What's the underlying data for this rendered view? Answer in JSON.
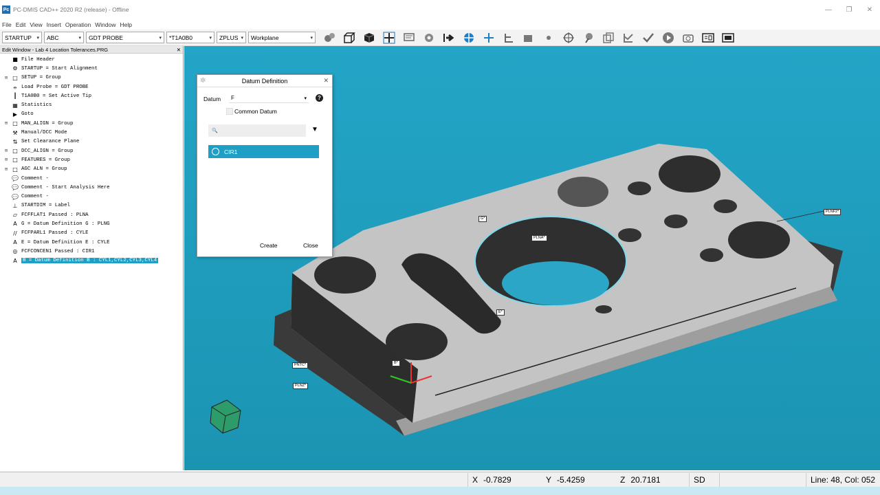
{
  "window": {
    "title": "PC-DMIS CAD++ 2020 R2 (release) - Offline",
    "icon_label": "Pc",
    "controls": [
      "—",
      "❐",
      "✕"
    ]
  },
  "menu": [
    "File",
    "Edit",
    "View",
    "Insert",
    "Operation",
    "Window",
    "Help"
  ],
  "toolbar": {
    "combos": [
      {
        "value": "STARTUP",
        "width": 58
      },
      {
        "value": "ABC",
        "width": 58
      },
      {
        "value": "GDT PROBE",
        "width": 114
      },
      {
        "value": "*T1A0B0",
        "width": 70
      },
      {
        "value": "ZPLUS",
        "width": 43
      },
      {
        "value": "Workplane",
        "width": 98
      }
    ]
  },
  "edit_window": {
    "title": "Edit Window - Lab 4 Location Tolerances.PRG",
    "close": "✕",
    "items": [
      {
        "exp": "",
        "icon": "■",
        "label": "File Header"
      },
      {
        "exp": "",
        "icon": "⚙",
        "label": "STARTUP = Start Alignment"
      },
      {
        "exp": "⊞",
        "icon": "□",
        "label": "SETUP = Group"
      },
      {
        "exp": "",
        "icon": "⦵",
        "label": "Load Probe = GDT PROBE"
      },
      {
        "exp": "",
        "icon": "┃",
        "label": "T1A0B0 = Set Active Tip"
      },
      {
        "exp": "",
        "icon": "▦",
        "label": "Statistics"
      },
      {
        "exp": "",
        "icon": "▶",
        "label": "Goto"
      },
      {
        "exp": "⊞",
        "icon": "□",
        "label": "MAN_ALIGN = Group"
      },
      {
        "exp": "",
        "icon": "⚒",
        "label": "Manual/DCC Mode"
      },
      {
        "exp": "",
        "icon": "⇅",
        "label": "Set Clearance Plane"
      },
      {
        "exp": "⊞",
        "icon": "□",
        "label": "DCC_ALIGN = Group"
      },
      {
        "exp": "⊞",
        "icon": "□",
        "label": "FEATURES = Group"
      },
      {
        "exp": "⊞",
        "icon": "□",
        "label": "AGC ALN = Group"
      },
      {
        "exp": "",
        "icon": "💬",
        "label": "Comment -"
      },
      {
        "exp": "",
        "icon": "💬",
        "label": "Comment - Start Analysis Here"
      },
      {
        "exp": "",
        "icon": "💬",
        "label": "Comment -"
      },
      {
        "exp": "",
        "icon": "⊥",
        "label": "STARTDIM = Label"
      },
      {
        "exp": "",
        "icon": "▱",
        "label": "FCFFLAT1 Passed : PLNA"
      },
      {
        "exp": "",
        "icon": "A",
        "label": "G = Datum Definition G : PLNG"
      },
      {
        "exp": "",
        "icon": "//",
        "label": "FCFPARL1 Passed : CYLE"
      },
      {
        "exp": "",
        "icon": "A",
        "label": "E = Datum Definition E : CYLE"
      },
      {
        "exp": "",
        "icon": "◎",
        "label": "FCFCONCEN1 Passed : CIR1"
      },
      {
        "exp": "",
        "icon": "A",
        "label": "B = Datum Definition B : CYL1,CYL2,CYL3,CYL4",
        "selected": true
      }
    ]
  },
  "dialog": {
    "title": "Datum Definition",
    "close": "✕",
    "datum_label": "Datum",
    "datum_value": "F",
    "help": "?",
    "common_datum": "Common Datum",
    "search_placeholder": "🔍",
    "filter_icon": "▼",
    "items": [
      "CIR1"
    ],
    "create": "Create",
    "close_btn": "Close"
  },
  "viewport": {
    "tags": [
      "G*",
      "PLNA*",
      "PLNF2*",
      "E*",
      "B*",
      "PNTC*",
      "PLNZ*"
    ]
  },
  "status": {
    "x_label": "X",
    "x": "-0.7829",
    "y_label": "Y",
    "y": "-5.4259",
    "z_label": "Z",
    "z": "20.7181",
    "sd": "SD",
    "line": "Line: 48, Col: 052"
  },
  "colors": {
    "accent": "#1e9fc6",
    "viewport": "#23a5c7",
    "part": "#bfbfbf"
  }
}
